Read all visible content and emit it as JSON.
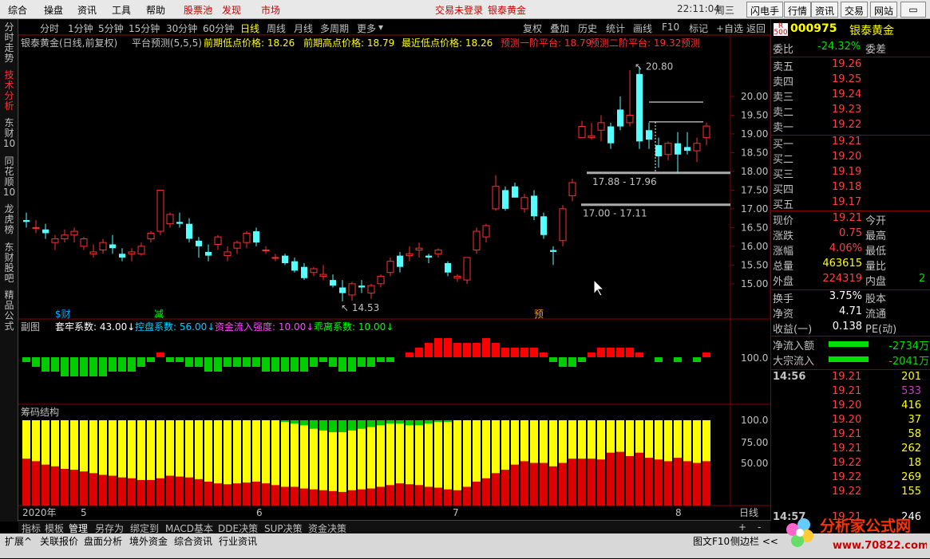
{
  "menu": {
    "items": [
      "综合",
      "操盘",
      "资讯",
      "工具",
      "帮助"
    ],
    "special": [
      "股票池",
      "发现",
      "市场"
    ],
    "status": "交易未登录",
    "stock_title": "银泰黄金",
    "time": "22:11:04",
    "weekday": "周三",
    "right_buttons": [
      "闪电手",
      "行情",
      "资讯",
      "交易",
      "网站"
    ]
  },
  "left_tabs": [
    "分时走势",
    "技术分析",
    "东财10",
    "同花顺10",
    "龙虎榜",
    "东财股吧",
    "精品公式"
  ],
  "periods": [
    "分时",
    "1分钟",
    "5分钟",
    "15分钟",
    "30分钟",
    "60分钟",
    "日线",
    "周线",
    "月线",
    "多周期",
    "更多"
  ],
  "active_period": "日线",
  "toolbar_right": [
    "复权",
    "叠加",
    "历史",
    "统计",
    "画线",
    "F10",
    "标记",
    "+自选",
    "返回"
  ],
  "main_chart": {
    "title": "银泰黄金(日线,前复权)",
    "indicator": "平台预测(5,5,5)",
    "fields": [
      {
        "label": "前期低点价格: 18.26",
        "color": "#ffff00"
      },
      {
        "label": "前期高点价格: 18.79",
        "color": "#ffff00"
      },
      {
        "label": "最近低点价格: 18.26",
        "color": "#ffff00"
      },
      {
        "label": "预测一阶平台: 18.79",
        "color": "#ff3030"
      },
      {
        "label": "预测二阶平台: 19.32",
        "color": "#ff3030"
      },
      {
        "label": "预测",
        "color": "#ff3030"
      }
    ],
    "high_label": "20.80",
    "low_label": "14.53",
    "platform1": "17.88 - 17.96",
    "platform2": "17.00 - 17.11",
    "markers": [
      {
        "text": "财",
        "color": "#00aaff"
      },
      {
        "text": "减",
        "color": "#00ff00"
      },
      {
        "text": "预",
        "color": "#ff9900"
      }
    ],
    "y_ticks": [
      "20.00",
      "19.50",
      "19.00",
      "18.50",
      "18.00",
      "17.50",
      "17.00",
      "16.50",
      "16.00",
      "15.50",
      "15.00"
    ]
  },
  "sub_chart": {
    "title": "副图",
    "fields": [
      {
        "label": "套牢系数: 43.00",
        "color": "#ffffff"
      },
      {
        "label": "控盘系数: 56.00",
        "color": "#00ccff"
      },
      {
        "label": "资金流入强度: 10.00",
        "color": "#ff44ff"
      },
      {
        "label": "乖离系数: 10.00",
        "color": "#00ff00"
      }
    ],
    "tick": "100.0"
  },
  "chip_chart": {
    "title": "筹码结构",
    "ticks": [
      "100.0",
      "75.00",
      "50.00"
    ]
  },
  "x_axis": [
    "2020年",
    "5",
    "6",
    "7",
    "8"
  ],
  "x_axis_right": "日线",
  "chart_data": {
    "type": "candlestick",
    "candles": [
      [
        16.7,
        16.9,
        16.5,
        16.65
      ],
      [
        16.5,
        16.7,
        16.35,
        16.5
      ],
      [
        16.45,
        16.6,
        16.2,
        16.35
      ],
      [
        16.1,
        16.3,
        15.9,
        16.2
      ],
      [
        16.2,
        16.45,
        16.1,
        16.3
      ],
      [
        16.3,
        16.5,
        16.1,
        16.4
      ],
      [
        16.0,
        16.25,
        15.9,
        16.2
      ],
      [
        15.8,
        16.05,
        15.7,
        15.85
      ],
      [
        15.9,
        16.2,
        15.8,
        16.1
      ],
      [
        16.05,
        16.3,
        15.8,
        15.95
      ],
      [
        15.8,
        15.95,
        15.6,
        15.7
      ],
      [
        15.8,
        15.95,
        15.6,
        15.85
      ],
      [
        15.8,
        16.1,
        15.75,
        16.0
      ],
      [
        16.2,
        16.4,
        16.1,
        16.35
      ],
      [
        16.4,
        17.5,
        16.3,
        17.5
      ],
      [
        16.6,
        16.9,
        16.5,
        16.85
      ],
      [
        16.65,
        16.9,
        16.5,
        16.6
      ],
      [
        16.6,
        16.75,
        16.1,
        16.2
      ],
      [
        16.15,
        16.25,
        15.7,
        16.0
      ],
      [
        15.85,
        16.05,
        15.6,
        15.75
      ],
      [
        16.05,
        16.3,
        15.9,
        16.25
      ],
      [
        15.75,
        16.0,
        15.6,
        15.85
      ],
      [
        15.95,
        16.15,
        15.8,
        16.1
      ],
      [
        16.1,
        16.4,
        15.95,
        16.35
      ],
      [
        16.4,
        16.5,
        16.0,
        16.1
      ],
      [
        15.9,
        16.0,
        15.8,
        15.9
      ],
      [
        15.7,
        15.8,
        15.6,
        15.7
      ],
      [
        15.75,
        15.8,
        15.5,
        15.55
      ],
      [
        15.6,
        15.7,
        15.3,
        15.35
      ],
      [
        15.45,
        15.55,
        15.1,
        15.15
      ],
      [
        15.3,
        15.45,
        15.2,
        15.4
      ],
      [
        15.2,
        15.5,
        15.1,
        15.25
      ],
      [
        15.1,
        15.25,
        14.9,
        14.95
      ],
      [
        14.9,
        15.1,
        14.53,
        14.75
      ],
      [
        14.7,
        15.05,
        14.55,
        15.0
      ],
      [
        14.95,
        15.1,
        14.75,
        14.9
      ],
      [
        14.75,
        15.0,
        14.6,
        14.95
      ],
      [
        15.0,
        15.25,
        14.9,
        15.2
      ],
      [
        15.3,
        15.7,
        15.2,
        15.6
      ],
      [
        15.75,
        15.85,
        15.3,
        15.45
      ],
      [
        15.75,
        16.0,
        15.6,
        15.8
      ],
      [
        15.9,
        16.1,
        15.7,
        15.95
      ],
      [
        15.75,
        15.8,
        15.55,
        15.7
      ],
      [
        15.8,
        15.95,
        15.7,
        15.9
      ],
      [
        15.55,
        15.6,
        15.2,
        15.3
      ],
      [
        15.15,
        15.25,
        15.05,
        15.2
      ],
      [
        15.1,
        15.7,
        15.0,
        15.7
      ],
      [
        15.9,
        16.5,
        15.8,
        16.4
      ],
      [
        16.25,
        16.6,
        16.1,
        16.55
      ],
      [
        17.0,
        17.9,
        16.95,
        17.6
      ],
      [
        17.5,
        17.6,
        16.95,
        17.0
      ],
      [
        17.6,
        17.7,
        17.3,
        17.3
      ],
      [
        17.0,
        17.4,
        16.9,
        17.3
      ],
      [
        17.35,
        17.5,
        16.7,
        16.8
      ],
      [
        16.8,
        16.9,
        16.2,
        16.3
      ],
      [
        15.9,
        16.0,
        15.5,
        15.85
      ],
      [
        16.15,
        17.1,
        16.0,
        17.0
      ],
      [
        17.35,
        17.8,
        17.2,
        17.7
      ],
      [
        18.9,
        19.35,
        18.9,
        19.2
      ],
      [
        18.9,
        19.3,
        18.85,
        18.95
      ],
      [
        19.1,
        19.5,
        18.8,
        19.3
      ],
      [
        19.2,
        19.3,
        18.6,
        18.75
      ],
      [
        19.65,
        20.0,
        19.1,
        19.2
      ],
      [
        19.3,
        20.7,
        19.2,
        19.5
      ],
      [
        20.6,
        20.8,
        18.6,
        18.8
      ],
      [
        19.1,
        19.3,
        18.6,
        18.85
      ],
      [
        18.7,
        18.9,
        18.1,
        18.4
      ],
      [
        18.45,
        18.8,
        18.3,
        18.75
      ],
      [
        18.75,
        19.05,
        17.95,
        18.45
      ],
      [
        18.65,
        19.05,
        18.45,
        18.55
      ],
      [
        18.55,
        18.9,
        18.25,
        18.75
      ],
      [
        18.9,
        19.3,
        18.7,
        19.21
      ]
    ],
    "sub_values": [
      -1,
      -2,
      -3,
      -3,
      -4,
      -4,
      -4,
      -4,
      -4,
      -3,
      -3,
      -3,
      -2,
      -1,
      1,
      -1,
      -1,
      -2,
      -2,
      -3,
      -3,
      -2,
      -2,
      -2,
      -2,
      -3,
      -3,
      -3,
      -3,
      -3,
      -2,
      -1,
      -2,
      -3,
      -3,
      -2,
      -2,
      -1,
      -1,
      0,
      1,
      2,
      3,
      4,
      4,
      3,
      3,
      3,
      4,
      3,
      2,
      2,
      2,
      2,
      1,
      -1,
      -2,
      -2,
      -1,
      1,
      2,
      2,
      2,
      2,
      1,
      0,
      -1,
      0,
      -1,
      0,
      -1,
      1
    ],
    "chip_values": [
      55,
      52,
      48,
      46,
      43,
      42,
      40,
      38,
      36,
      35,
      33,
      32,
      30,
      30,
      32,
      35,
      34,
      33,
      31,
      28,
      26,
      25,
      26,
      27,
      28,
      26,
      24,
      22,
      22,
      20,
      19,
      18,
      17,
      16,
      18,
      19,
      20,
      22,
      24,
      26,
      25,
      24,
      22,
      21,
      19,
      18,
      22,
      28,
      32,
      38,
      42,
      48,
      52,
      50,
      50,
      46,
      50,
      55,
      55,
      55,
      54,
      62,
      63,
      58,
      62,
      56,
      54,
      52,
      56,
      52,
      50,
      52
    ],
    "chip_green": [
      0,
      0,
      0,
      0,
      0,
      0,
      0,
      0,
      0,
      0,
      0,
      0,
      0,
      0,
      0,
      0,
      0,
      0,
      0,
      0,
      0,
      0,
      0,
      0,
      0,
      0,
      0,
      2,
      4,
      6,
      10,
      12,
      14,
      14,
      12,
      10,
      8,
      6,
      4,
      4,
      6,
      6,
      4,
      2,
      2,
      0,
      0,
      0,
      0,
      0,
      0,
      0,
      0,
      0,
      0,
      0,
      0,
      0,
      0,
      0,
      0,
      0,
      0,
      0,
      0,
      0,
      0,
      0,
      0,
      0,
      0,
      0
    ],
    "ylim": [
      14.4,
      21.0
    ]
  },
  "right_panel": {
    "code": "000975",
    "name": "银泰黄金",
    "weibi_label": "委比",
    "weibi": "-24.32%",
    "weicha_label": "委差",
    "asks": [
      {
        "label": "卖五",
        "price": "19.26"
      },
      {
        "label": "卖四",
        "price": "19.25"
      },
      {
        "label": "卖三",
        "price": "19.24"
      },
      {
        "label": "卖二",
        "price": "19.23"
      },
      {
        "label": "卖一",
        "price": "19.22"
      }
    ],
    "bids": [
      {
        "label": "买一",
        "price": "19.21"
      },
      {
        "label": "买二",
        "price": "19.20"
      },
      {
        "label": "买三",
        "price": "19.19"
      },
      {
        "label": "买四",
        "price": "19.18"
      },
      {
        "label": "买五",
        "price": "19.17"
      }
    ],
    "stats": [
      {
        "l1": "现价",
        "v1": "19.21",
        "c1": "red",
        "l2": "今开"
      },
      {
        "l1": "涨跌",
        "v1": "0.75",
        "c1": "red",
        "l2": "最高"
      },
      {
        "l1": "涨幅",
        "v1": "4.06%",
        "c1": "red",
        "l2": "最低"
      },
      {
        "l1": "总量",
        "v1": "463615",
        "c1": "yellow",
        "l2": "量比"
      },
      {
        "l1": "外盘",
        "v1": "224319",
        "c1": "red",
        "l2": "内盘",
        "v2": "2"
      }
    ],
    "stats2": [
      {
        "l1": "换手",
        "v1": "3.75%",
        "c1": "white",
        "l2": "股本"
      },
      {
        "l1": "净资",
        "v1": "4.71",
        "c1": "white",
        "l2": "流通"
      },
      {
        "l1": "收益(一)",
        "v1": "0.138",
        "c1": "white",
        "l2": "PE(动)"
      }
    ],
    "flows": [
      {
        "label": "净流入额",
        "value": "-2734万"
      },
      {
        "label": "大宗流入",
        "value": "-2041万"
      }
    ],
    "ticks": [
      {
        "time": "14:56",
        "price": "19.21",
        "vol": "201",
        "vc": "yellow"
      },
      {
        "time": "",
        "price": "19.21",
        "vol": "533",
        "vc": "purple"
      },
      {
        "time": "",
        "price": "19.20",
        "vol": "416",
        "vc": "yellow"
      },
      {
        "time": "",
        "price": "19.20",
        "vol": "37",
        "vc": "yellow"
      },
      {
        "time": "",
        "price": "19.21",
        "vol": "58",
        "vc": "yellow"
      },
      {
        "time": "",
        "price": "19.21",
        "vol": "262",
        "vc": "yellow"
      },
      {
        "time": "",
        "price": "19.22",
        "vol": "18",
        "vc": "yellow"
      },
      {
        "time": "",
        "price": "19.22",
        "vol": "269",
        "vc": "yellow"
      },
      {
        "time": "",
        "price": "19.22",
        "vol": "155",
        "vc": "yellow"
      },
      {
        "time": "14:57",
        "price": "19.21",
        "vol": "246",
        "vc": "white"
      }
    ]
  },
  "bottom_tabs": [
    "指标",
    "模板",
    "管理",
    "另存为",
    "绑定到",
    "MACD基本",
    "DDE决策",
    "SUP决策",
    "资金决策"
  ],
  "bottom_right": [
    "+",
    "-"
  ],
  "status_items": [
    "扩展^",
    "关联报价",
    "盘面分析",
    "境外资金",
    "综合资讯",
    "行业资讯"
  ],
  "status_right": [
    "图文F10",
    "侧边栏 <<"
  ],
  "logo_text": "分析家公式网",
  "logo_url": "www.70822.com"
}
